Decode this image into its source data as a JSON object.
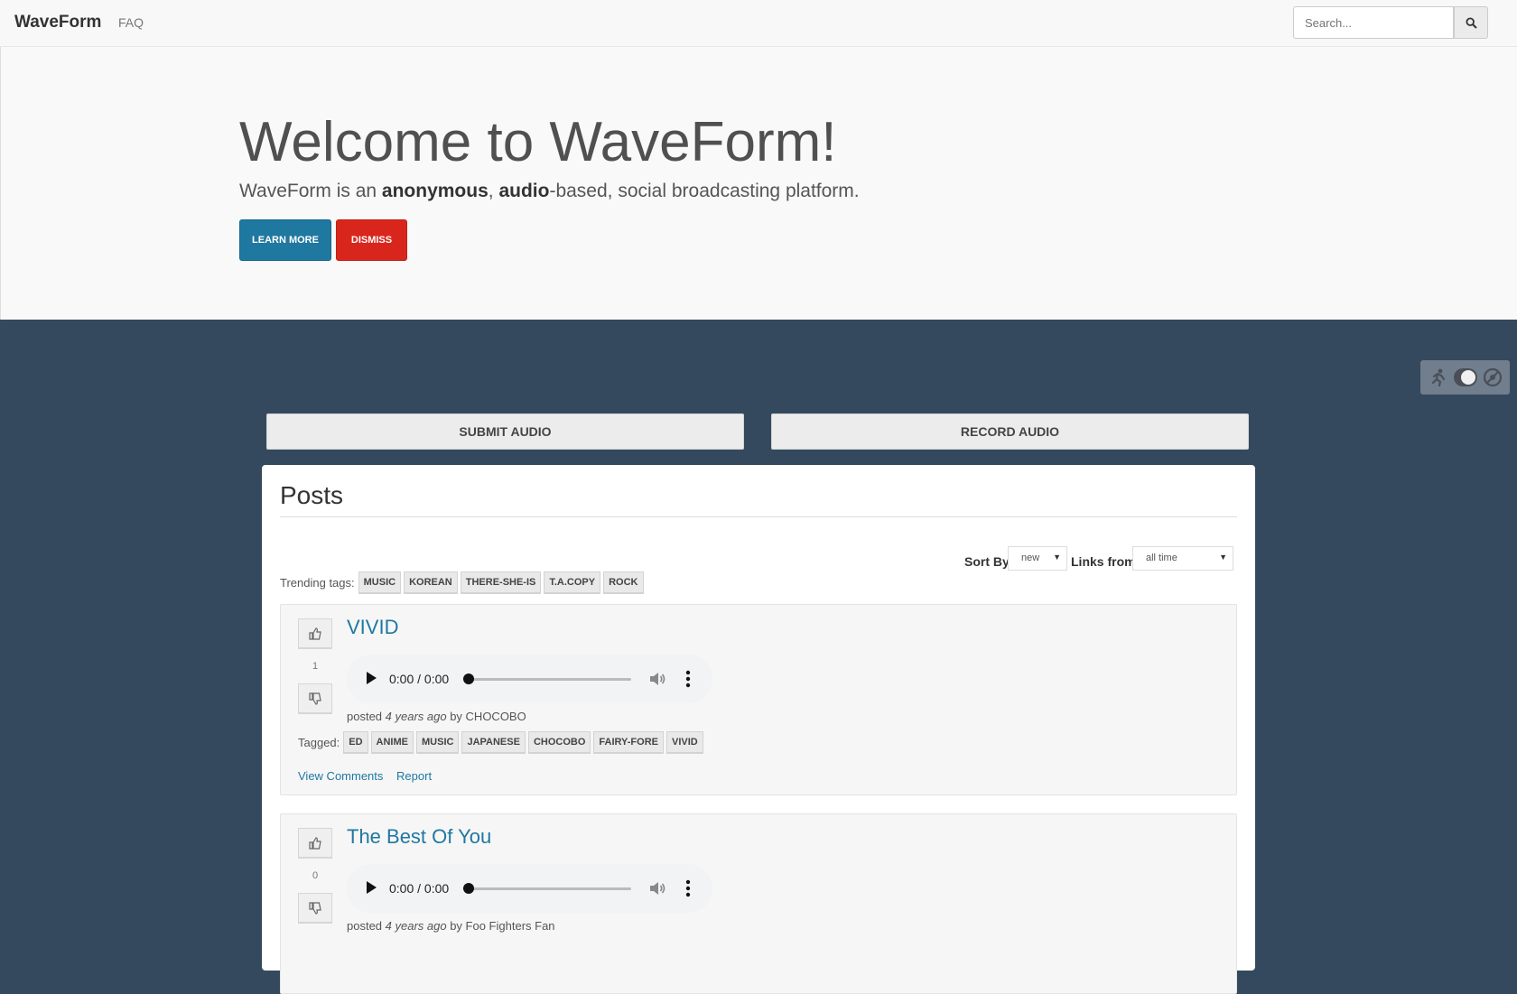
{
  "nav": {
    "brand": "WaveForm",
    "faq": "FAQ",
    "search_placeholder": "Search..."
  },
  "hero": {
    "title": "Welcome to WaveForm!",
    "lead_prefix": "WaveForm is an ",
    "lead_bold1": "anonymous",
    "lead_sep": ", ",
    "lead_bold2": "audio",
    "lead_suffix": "-based, social broadcasting platform.",
    "learn_more": "LEARN MORE",
    "dismiss": "DISMISS"
  },
  "actions": {
    "submit": "SUBMIT AUDIO",
    "record": "RECORD AUDIO"
  },
  "posts": {
    "title": "Posts",
    "sort_by_label": "Sort By",
    "sort_value": "new",
    "links_from_label": "Links from",
    "links_from_value": "all time",
    "trending_label": "Trending tags:",
    "trending_tags": [
      "MUSIC",
      "KOREAN",
      "THERE-SHE-IS",
      "T.A.COPY",
      "ROCK"
    ],
    "items": [
      {
        "title": "VIVID",
        "votes": "1",
        "time": "0:00 / 0:00",
        "posted": "posted ",
        "ago": "4 years ago",
        "by": " by CHOCOBO",
        "tagged_label": "Tagged:",
        "tags": [
          "ED",
          "ANIME",
          "MUSIC",
          "JAPANESE",
          "CHOCOBO",
          "FAIRY-FORE",
          "VIVID"
        ],
        "view_comments": "View Comments",
        "report": "Report"
      },
      {
        "title": "The Best Of You",
        "votes": "0",
        "time": "0:00 / 0:00",
        "posted": "posted ",
        "ago": "4 years ago",
        "by": " by Foo Fighters Fan"
      }
    ]
  },
  "colors": {
    "accent": "#1f78a0",
    "danger": "#d9261c",
    "background": "#34495e"
  }
}
